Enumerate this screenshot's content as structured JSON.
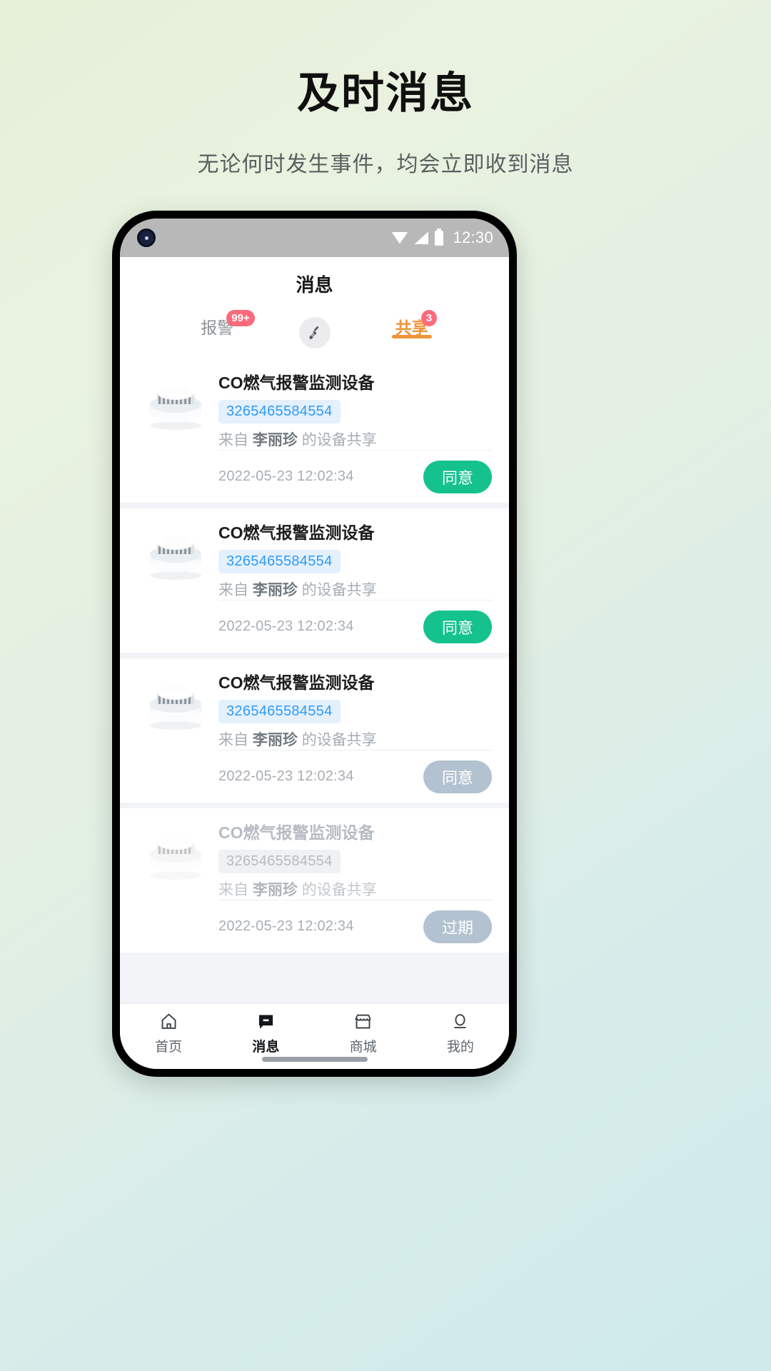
{
  "promo": {
    "title": "及时消息",
    "subtitle": "无论何时发生事件，均会立即收到消息"
  },
  "status_bar": {
    "time": "12:30",
    "icons": [
      "wifi-icon",
      "signal-icon",
      "battery-icon"
    ]
  },
  "header": {
    "title": "消息"
  },
  "tabs": [
    {
      "label": "报警",
      "badge": "99+",
      "active": false
    },
    {
      "label": "共享",
      "badge": "3",
      "active": true
    }
  ],
  "clean_button": {
    "icon": "broom-icon",
    "label": ""
  },
  "colors": {
    "accent_orange": "#F09438",
    "badge_red": "#FB6B7B",
    "agree_green": "#15C28E",
    "disabled_gray": "#b3c2d0",
    "id_blue": "#2f9bf5",
    "id_blue_bg": "#e4f0fc"
  },
  "messages": [
    {
      "device_name": "CO燃气报警监测设备",
      "device_id": "3265465584554",
      "from_prefix": "来自",
      "from_name": "李丽珍",
      "from_suffix": "的设备共享",
      "timestamp": "2022-05-23 12:02:34",
      "action_label": "同意",
      "state": "active"
    },
    {
      "device_name": "CO燃气报警监测设备",
      "device_id": "3265465584554",
      "from_prefix": "来自",
      "from_name": "李丽珍",
      "from_suffix": "的设备共享",
      "timestamp": "2022-05-23 12:02:34",
      "action_label": "同意",
      "state": "active"
    },
    {
      "device_name": "CO燃气报警监测设备",
      "device_id": "3265465584554",
      "from_prefix": "来自",
      "from_name": "李丽珍",
      "from_suffix": "的设备共享",
      "timestamp": "2022-05-23 12:02:34",
      "action_label": "同意",
      "state": "disabled"
    },
    {
      "device_name": "CO燃气报警监测设备",
      "device_id": "3265465584554",
      "from_prefix": "来自",
      "from_name": "李丽珍",
      "from_suffix": "的设备共享",
      "timestamp": "2022-05-23 12:02:34",
      "action_label": "过期",
      "state": "expired"
    }
  ],
  "bottom_nav": [
    {
      "label": "首页",
      "icon": "home-icon",
      "active": false
    },
    {
      "label": "消息",
      "icon": "message-icon",
      "active": true
    },
    {
      "label": "商城",
      "icon": "store-icon",
      "active": false
    },
    {
      "label": "我的",
      "icon": "person-icon",
      "active": false
    }
  ]
}
